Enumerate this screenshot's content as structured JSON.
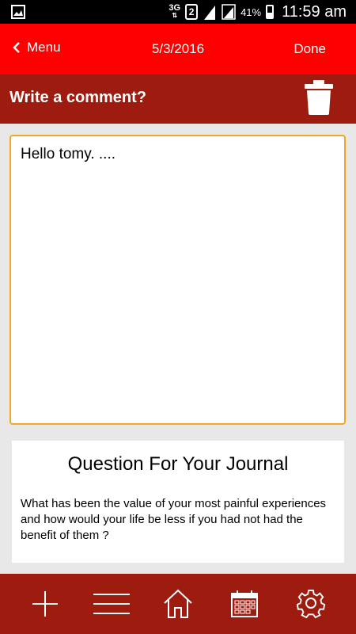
{
  "status_bar": {
    "network": "3G",
    "sim": "2",
    "roaming": "R",
    "battery_percent": "41%",
    "time": "11:59 am"
  },
  "topbar": {
    "back_label": "Menu",
    "date": "5/3/2016",
    "done_label": "Done"
  },
  "comment_header": {
    "title": "Write a comment?"
  },
  "comment": {
    "value": "Hello tomy. ...."
  },
  "journal_question": {
    "heading": "Question For Your Journal",
    "text": "What has been the value of your most painful experiences and how would your life be less if you had not had the benefit of them ?"
  },
  "bottom_nav": [
    {
      "icon": "plus-icon"
    },
    {
      "icon": "menu-icon"
    },
    {
      "icon": "home-icon"
    },
    {
      "icon": "calendar-icon"
    },
    {
      "icon": "settings-icon"
    }
  ],
  "colors": {
    "topbar": "#ff0000",
    "dark_red": "#9e1b0f",
    "focus_border": "#f5a623",
    "background": "#e8e8e8"
  }
}
